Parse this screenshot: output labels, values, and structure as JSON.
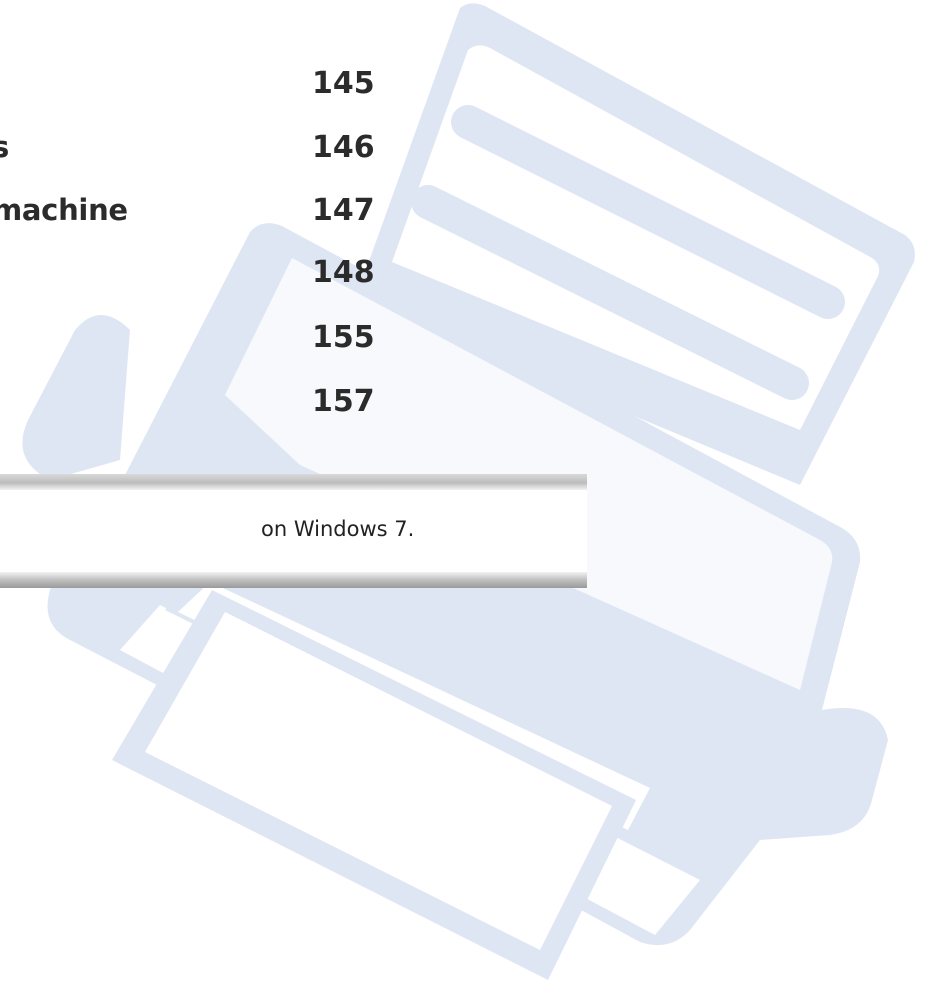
{
  "toc": {
    "entries": [
      {
        "title": "s",
        "page": "146"
      },
      {
        "title": "machine",
        "page": "147"
      }
    ],
    "pages_only": [
      "145",
      "148",
      "155",
      "157"
    ]
  },
  "note": {
    "text": "on Windows 7."
  },
  "colors": {
    "illustration": "#dfe6f3",
    "text": "#2b2b2b"
  },
  "icons": {
    "background": "printer-illustration-icon"
  }
}
